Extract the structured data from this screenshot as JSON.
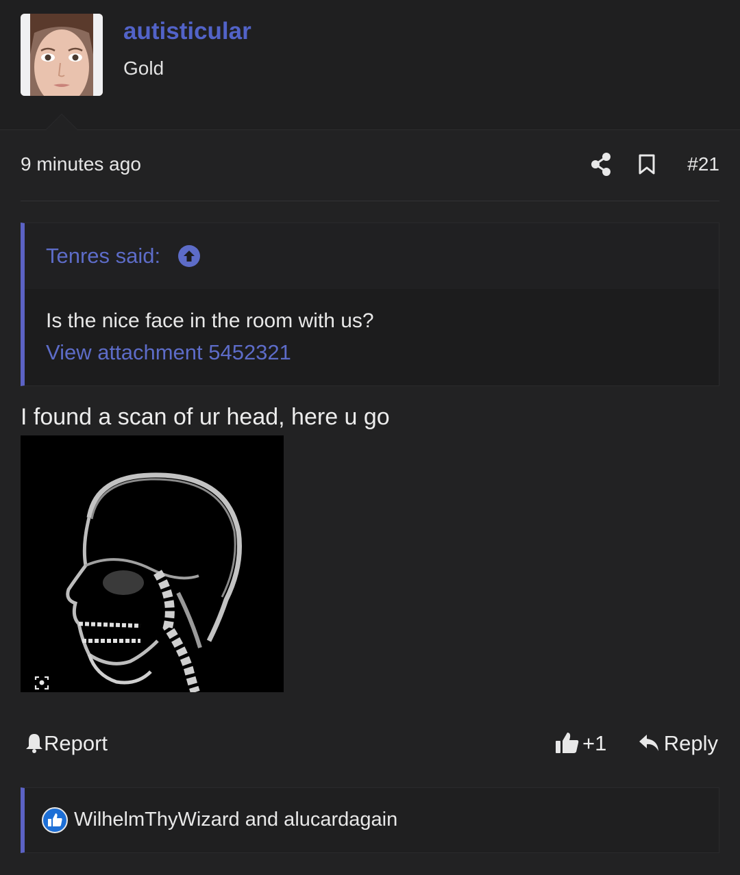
{
  "user": {
    "name": "autisticular",
    "title": "Gold"
  },
  "post": {
    "timestamp": "9 minutes ago",
    "number": "#21",
    "body": "I found a scan of ur head, here u go"
  },
  "quote": {
    "author": "Tenres said:",
    "text": "Is the nice face in the room with us?",
    "attachment": "View attachment 5452321"
  },
  "actions": {
    "report": "Report",
    "like": "+1",
    "reply": "Reply"
  },
  "reactions": {
    "users": "WilhelmThyWizard and alucardagain"
  },
  "colors": {
    "accent": "#5263c8",
    "background": "#222223",
    "quote_bar": "#5b62c4"
  },
  "icons": [
    "share-icon",
    "bookmark-icon",
    "arrow-up-circle-icon",
    "bell-icon",
    "thumbs-up-icon",
    "reply-arrow-icon",
    "like-badge-icon",
    "lens-icon"
  ]
}
